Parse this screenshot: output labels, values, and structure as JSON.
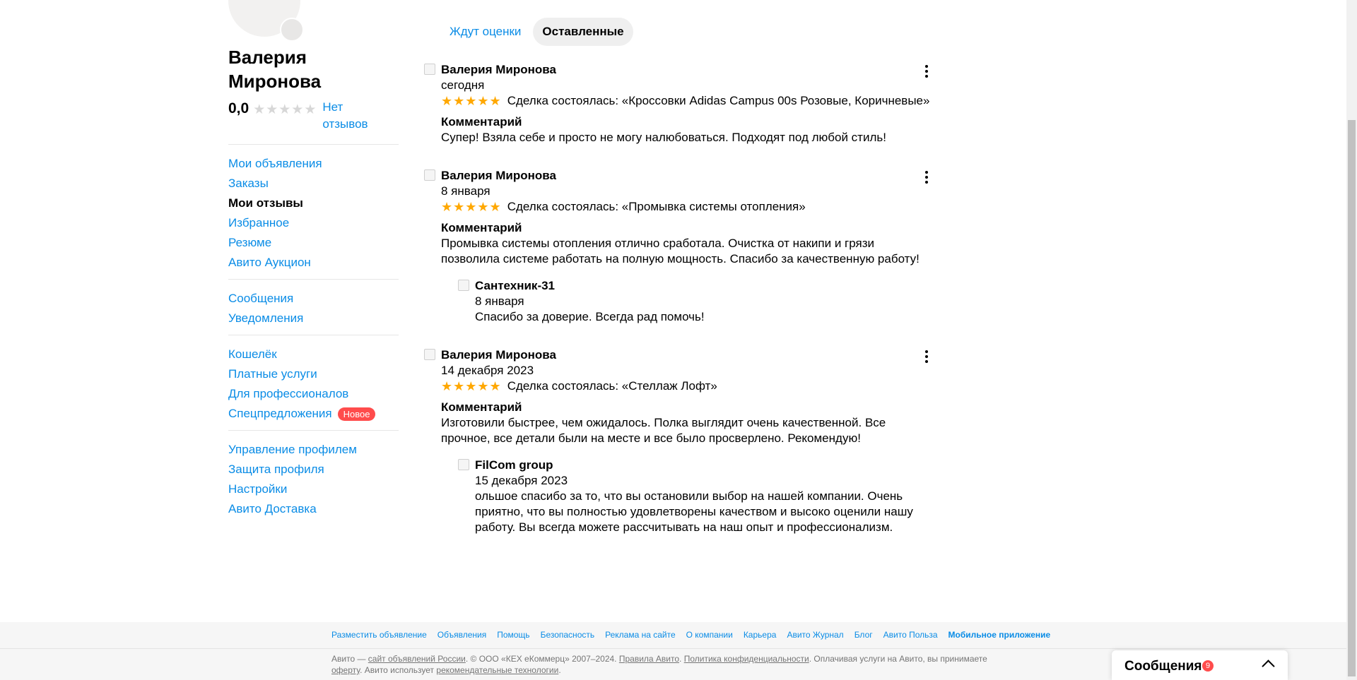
{
  "profile": {
    "name": "Валерия Миронова",
    "rating": "0,0",
    "stars": "★★★★★",
    "no_reviews": "Нет отзывов"
  },
  "sidebar": {
    "groups": [
      [
        {
          "label": "Мои объявления"
        },
        {
          "label": "Заказы"
        },
        {
          "label": "Мои отзывы",
          "active": true
        },
        {
          "label": "Избранное"
        },
        {
          "label": "Резюме"
        },
        {
          "label": "Авито Аукцион"
        }
      ],
      [
        {
          "label": "Сообщения"
        },
        {
          "label": "Уведомления"
        }
      ],
      [
        {
          "label": "Кошелёк"
        },
        {
          "label": "Платные услуги"
        },
        {
          "label": "Для профессионалов"
        },
        {
          "label": "Спецпредложения",
          "badge": "Новое"
        }
      ],
      [
        {
          "label": "Управление профилем"
        },
        {
          "label": "Защита профиля"
        },
        {
          "label": "Настройки"
        },
        {
          "label": "Авито Доставка"
        }
      ]
    ]
  },
  "tabs": [
    {
      "label": "Ждут оценки",
      "active": false
    },
    {
      "label": "Оставленные",
      "active": true
    }
  ],
  "reviews": [
    {
      "author": "Валерия Миронова",
      "date": "сегодня",
      "stars": "★★★★★",
      "rating": 5,
      "deal": "Сделка состоялась: «Кроссовки Adidas Campus 00s Розовые, Коричневые»",
      "comment_title": "Комментарий",
      "comment": "Супер! Взяла себе и просто не могу налюбоваться. Подходят под любой стиль!"
    },
    {
      "author": "Валерия Миронова",
      "date": "8 января",
      "stars": "★★★★★",
      "rating": 5,
      "deal": "Сделка состоялась: «Промывка системы отопления»",
      "comment_title": "Комментарий",
      "comment": "Промывка системы отопления отлично сработала. Очистка от накипи и грязи позволила системе работать на полную мощность. Спасибо за качественную работу!",
      "answer": {
        "author": "Сантехник-31",
        "date": "8 января",
        "text": "Спасибо за доверие. Всегда рад помочь!"
      }
    },
    {
      "author": "Валерия Миронова",
      "date": "14 декабря 2023",
      "stars": "★★★★★",
      "rating": 5,
      "deal": "Сделка состоялась: «Стеллаж Лофт»",
      "comment_title": "Комментарий",
      "comment": "Изготовили быстрее, чем ожидалось. Полка выглядит очень качественной. Все прочное, все детали были на месте и все было просверлено. Рекомендую!",
      "answer": {
        "author": "FilCom group",
        "date": "15 декабря 2023",
        "text": "ольшое спасибо за то, что вы остановили выбор на нашей компании. Очень приятно, что вы полностью удовлетворены качеством и высоко оценили нашу работу. Вы всегда можете рассчитывать на наш опыт и профессионализм."
      }
    }
  ],
  "footer": {
    "links": [
      {
        "label": "Разместить объявление"
      },
      {
        "label": "Объявления"
      },
      {
        "label": "Помощь"
      },
      {
        "label": "Безопасность"
      },
      {
        "label": "Реклама на сайте"
      },
      {
        "label": "О компании"
      },
      {
        "label": "Карьера"
      },
      {
        "label": "Авито Журнал"
      },
      {
        "label": "Блог"
      },
      {
        "label": "Авито Польза"
      },
      {
        "label": "Мобильное приложение",
        "bold": true
      }
    ],
    "legal": {
      "p1": "Авито — ",
      "link1": "сайт объявлений России",
      "p2": ". © ООО «КЕХ еКоммерц» 2007–2024. ",
      "link2": "Правила Авито",
      "p3": ". ",
      "link3": "Политика конфиденциальности",
      "p4": ". Оплачивая услуги на Авито, вы принимаете ",
      "link4": "оферту",
      "p5": ". Авито использует ",
      "link5": "рекомендательные технологии",
      "p6": "."
    }
  },
  "messages_widget": {
    "title": "Сообщения",
    "count": "9"
  },
  "colors": {
    "link": "#0a8ce6",
    "star_active": "#ffa800",
    "star_inactive": "#d7d7d7",
    "badge": "#ff4c4c"
  }
}
